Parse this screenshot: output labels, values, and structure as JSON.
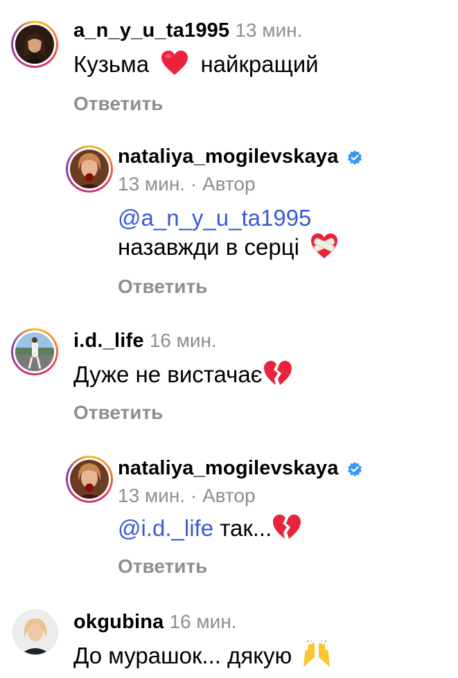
{
  "comments": [
    {
      "username": "a_n_y_u_ta1995",
      "time": "13 мин.",
      "text_before": "Кузьма",
      "text_after": "найкращий",
      "reply_label": "Ответить"
    },
    {
      "username": "nataliya_mogilevskaya",
      "meta": "13 мин. · Автор",
      "mention": "@a_n_y_u_ta1995",
      "text": "назавжди в серці",
      "reply_label": "Ответить"
    },
    {
      "username": "i.d._life",
      "time": "16 мин.",
      "text": "Дуже не вистачає",
      "reply_label": "Ответить"
    },
    {
      "username": "nataliya_mogilevskaya",
      "meta": "13 мин. · Автор",
      "mention": "@i.d._life",
      "text": " так...",
      "reply_label": "Ответить"
    },
    {
      "username": "okgubina",
      "time": "16 мин.",
      "text": "До мурашок... дякую"
    }
  ],
  "colors": {
    "mention": "#3b57d6",
    "secondary_text": "#8e8e8e",
    "verified": "#3897f0",
    "heart": "#e8233b"
  },
  "icons": [
    "red-heart-icon",
    "mending-heart-icon",
    "broken-heart-icon",
    "verified-badge-icon",
    "raising-hands-icon"
  ]
}
